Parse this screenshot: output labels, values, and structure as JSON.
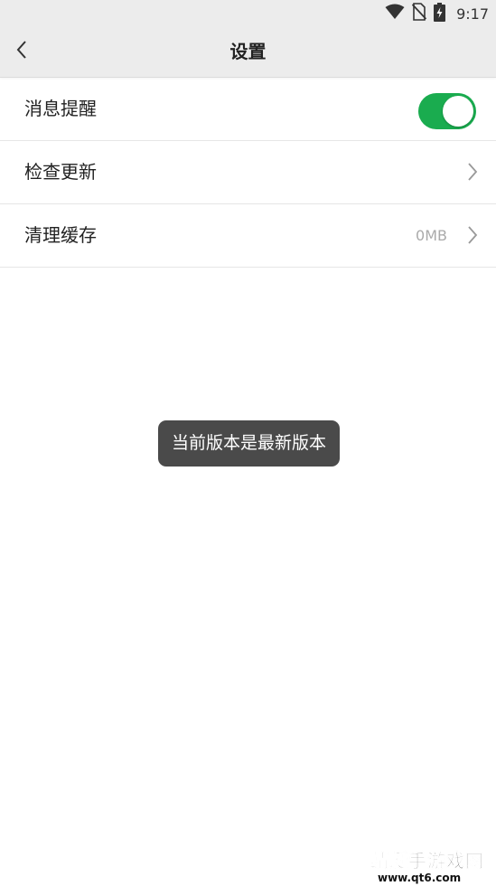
{
  "status_bar": {
    "time": "9:17",
    "icons": [
      "wifi-icon",
      "no-sim-icon",
      "battery-charging-icon"
    ]
  },
  "header": {
    "title": "设置",
    "back_icon": "chevron-left-icon"
  },
  "settings": {
    "message_reminder": {
      "label": "消息提醒",
      "toggle_on": true,
      "accent_color": "#1aac4f"
    },
    "check_update": {
      "label": "检查更新",
      "icon": "chevron-right-icon"
    },
    "clear_cache": {
      "label": "清理缓存",
      "value": "0MB",
      "icon": "chevron-right-icon"
    }
  },
  "toast": {
    "text": "当前版本是最新版本"
  },
  "watermark": {
    "title": "蜻蜓手游戏网",
    "url": "www.qt6.com"
  }
}
